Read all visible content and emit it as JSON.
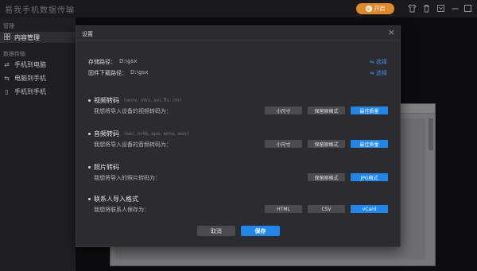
{
  "app": {
    "title": "易我手机数据传输",
    "open_button": "开启",
    "open_icon": "crown-icon"
  },
  "sidebar": {
    "section1": "管理",
    "section2": "数据传输",
    "items": [
      {
        "label": "内容管理",
        "icon": "grid-icon",
        "active": true
      },
      {
        "label": "手机到电脑",
        "icon": "phone-to-pc-icon",
        "active": false
      },
      {
        "label": "电脑到手机",
        "icon": "pc-to-phone-icon",
        "active": false
      },
      {
        "label": "手机到手机",
        "icon": "phone-to-phone-icon",
        "active": false
      }
    ]
  },
  "dialog": {
    "title": "设置",
    "storage_label": "存储路径：",
    "storage_value": "D:\\gsx",
    "firmware_label": "固件下载路径：",
    "firmware_value": "D:\\gsx",
    "choose_label": "选择",
    "video": {
      "name": "视频转码",
      "formats": "(wmv, mkv, avi, flv, rm)",
      "desc": "我想将导入设备的视频转码为：",
      "options": [
        "小尺寸",
        "保留原格式",
        "最佳质量"
      ],
      "selected": 2
    },
    "audio": {
      "name": "音频转码",
      "formats": "(aac, m4b, ape, wma, wav)",
      "desc": "我想将导入设备的音频转码为：",
      "options": [
        "小尺寸",
        "保留原格式",
        "最佳质量"
      ],
      "selected": 2
    },
    "photo": {
      "name": "照片转码",
      "desc": "我想将导入的照片转码为：",
      "options": [
        "保留原格式",
        "JPG格式"
      ],
      "selected": 1
    },
    "contacts": {
      "name": "联系人导入格式",
      "desc": "我想将联系人保存为：",
      "options": [
        "HTML",
        "CSV",
        "vCard"
      ],
      "selected": 2
    },
    "cancel": "取消",
    "save": "保存"
  },
  "colors": {
    "accent": "#1f86ec",
    "open_button": "#e08a2a",
    "link": "#3d8ee8"
  }
}
